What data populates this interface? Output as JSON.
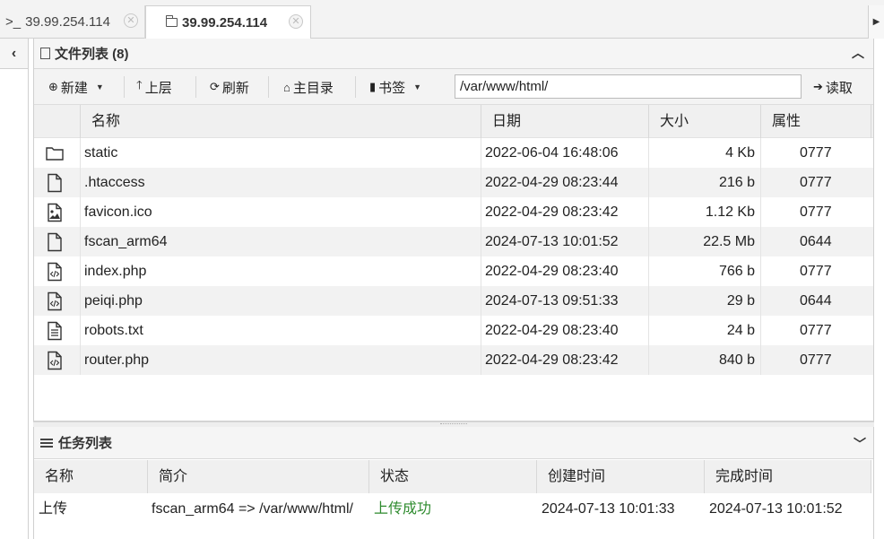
{
  "tabs": [
    {
      "prefix": ">_",
      "label": "39.99.254.114",
      "active": false
    },
    {
      "label": "39.99.254.114",
      "active": true
    }
  ],
  "file_panel": {
    "title": "文件列表 (8)",
    "toolbar": {
      "new_label": "新建",
      "up_label": "上层",
      "refresh_label": "刷新",
      "home_label": "主目录",
      "bookmark_label": "书签",
      "path_value": "/var/www/html/",
      "read_label": "读取"
    },
    "columns": {
      "name": "名称",
      "date": "日期",
      "size": "大小",
      "attr": "属性"
    },
    "files": [
      {
        "icon": "folder-icon",
        "name": "static",
        "date": "2022-06-04 16:48:06",
        "size": "4 Kb",
        "attr": "0777"
      },
      {
        "icon": "file-icon",
        "name": ".htaccess",
        "date": "2022-04-29 08:23:44",
        "size": "216 b",
        "attr": "0777"
      },
      {
        "icon": "image-file-icon",
        "name": "favicon.ico",
        "date": "2022-04-29 08:23:42",
        "size": "1.12 Kb",
        "attr": "0777"
      },
      {
        "icon": "file-icon",
        "name": "fscan_arm64",
        "date": "2024-07-13 10:01:52",
        "size": "22.5 Mb",
        "attr": "0644"
      },
      {
        "icon": "code-file-icon",
        "name": "index.php",
        "date": "2022-04-29 08:23:40",
        "size": "766 b",
        "attr": "0777"
      },
      {
        "icon": "code-file-icon",
        "name": "peiqi.php",
        "date": "2024-07-13 09:51:33",
        "size": "29 b",
        "attr": "0644"
      },
      {
        "icon": "text-file-icon",
        "name": "robots.txt",
        "date": "2022-04-29 08:23:40",
        "size": "24 b",
        "attr": "0777"
      },
      {
        "icon": "code-file-icon",
        "name": "router.php",
        "date": "2022-04-29 08:23:42",
        "size": "840 b",
        "attr": "0777"
      }
    ]
  },
  "task_panel": {
    "title": "任务列表",
    "columns": {
      "name": "名称",
      "desc": "简介",
      "status": "状态",
      "created": "创建时间",
      "finished": "完成时间"
    },
    "tasks": [
      {
        "name": "上传",
        "desc": "fscan_arm64 => /var/www/html/",
        "status": "上传成功",
        "created": "2024-07-13 10:01:33",
        "finished": "2024-07-13 10:01:52"
      }
    ]
  },
  "colors": {
    "success": "#2e8b2e"
  }
}
